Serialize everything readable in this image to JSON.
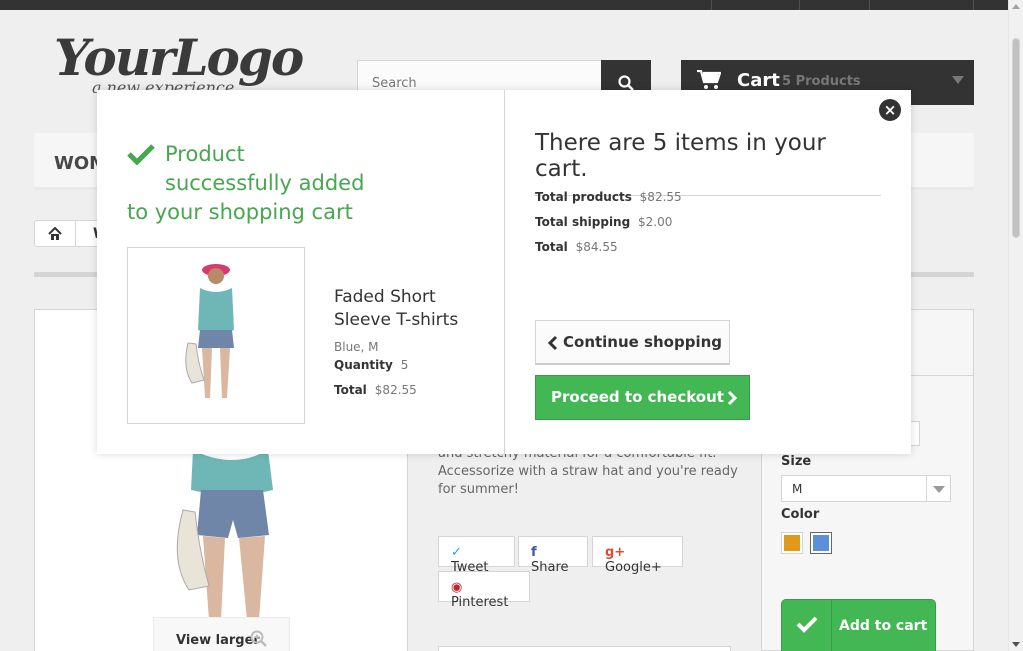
{
  "header": {
    "logo_main": "YourLogo",
    "logo_sub": "a new experience",
    "search": {
      "placeholder": "Search"
    },
    "cart": {
      "label": "Cart",
      "count": "5 Products"
    }
  },
  "menu": {
    "first_item": "WOM"
  },
  "breadcrumb": {
    "item": "W"
  },
  "product_page": {
    "view_larger": "View larger",
    "description": "and stretchy material for a comfortable fit. Accessorize with a straw hat and you're ready for summer!",
    "share": {
      "tweet": "Tweet",
      "share": "Share",
      "google": "Google+",
      "pinterest": "Pinterest"
    },
    "size_label": "Size",
    "size_value": "M",
    "color_label": "Color",
    "colors": [
      "#e09a1b",
      "#5b8fdb"
    ],
    "add_to_cart": "Add to cart"
  },
  "modal": {
    "title": "Product successfully added to your shopping cart",
    "title_lines": [
      "Product",
      "successfully added",
      "to your shopping cart"
    ],
    "product_name": "Faded Short Sleeve T-shirts",
    "attributes": "Blue, M",
    "quantity_label": "Quantity",
    "quantity": "5",
    "total_label": "Total",
    "total": "$82.55",
    "cart_heading": "There are 5 items in your cart.",
    "total_products_label": "Total products",
    "total_products": "$82.55",
    "total_shipping_label": "Total shipping",
    "total_shipping": "$2.00",
    "grand_total_label": "Total",
    "grand_total": "$84.55",
    "continue_label": "Continue shopping",
    "checkout_label": "Proceed to checkout"
  },
  "icons": [
    "search-icon",
    "cart-icon",
    "chevron-down-icon",
    "home-icon",
    "zoom-icon",
    "check-icon",
    "chevron-left-icon",
    "chevron-right-icon",
    "close-icon",
    "twitter-icon",
    "facebook-icon",
    "google-plus-icon",
    "pinterest-icon"
  ],
  "colors": {
    "green": "#46a74e",
    "button_green": "#43b754",
    "dark": "#333333"
  }
}
